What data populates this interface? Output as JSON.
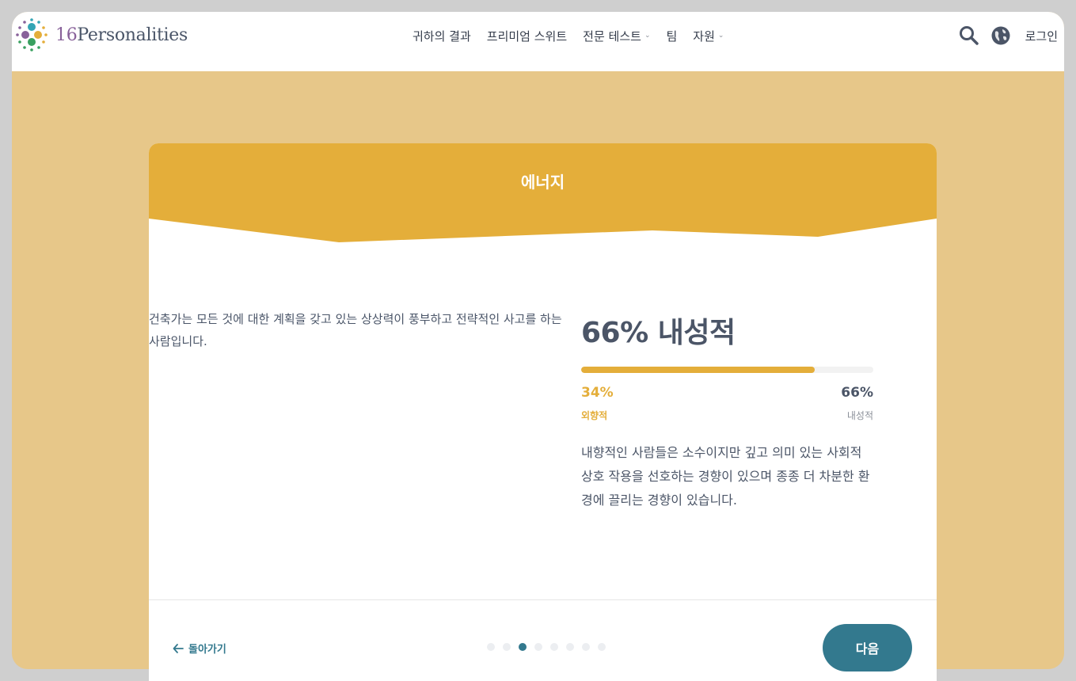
{
  "header": {
    "logo_number": "16",
    "logo_word": "Personalities",
    "nav": [
      {
        "label": "귀하의 결과"
      },
      {
        "label": "프리미엄 스위트"
      },
      {
        "label": "전문 테스트"
      },
      {
        "label": "팀"
      },
      {
        "label": "자원"
      }
    ],
    "login_label": "로그인",
    "icons": [
      "search-icon",
      "globe-icon",
      "chevron-down-icon",
      "arrow-left-icon"
    ]
  },
  "card": {
    "title": "에너지",
    "description": "건축가는 모든 것에 대한 계획을 갖고 있는 상상력이 풍부하고 전략적인 사고를 하는 사람입니다.",
    "result_title": "66% 내성적",
    "left_percent_label": "34%",
    "right_percent_label": "66%",
    "left_trait": "외향적",
    "right_trait": "내성적",
    "progress_fraction": 0.8,
    "trait_description": "내향적인 사람들은 소수이지만 깊고 의미 있는 사회적 상호 작용을 선호하는 경향이 있으며 종종 더 차분한 환경에 끌리는 경향이 있습니다."
  },
  "footer": {
    "back_label": "돌아가기",
    "next_label": "다음",
    "dot_count": 8,
    "active_dot": 2
  },
  "colors": {
    "accent": "#e4ae3a",
    "primary": "#33798e",
    "background": "#efce8d",
    "text": "#4b5567"
  }
}
